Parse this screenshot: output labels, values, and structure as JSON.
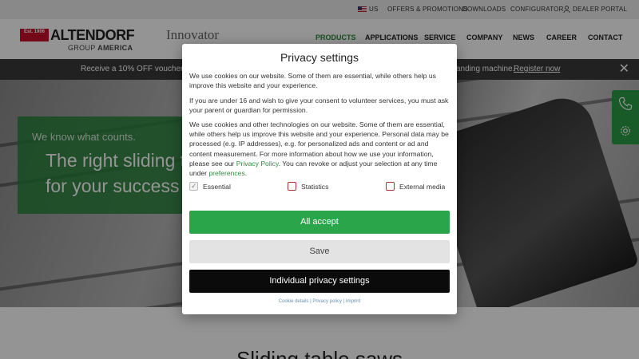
{
  "topbar": {
    "country": "US",
    "offers": "OFFERS & PROMOTIONS",
    "downloads": "DOWNLOADS",
    "configurator": "CONFIGURATOR",
    "dealer_portal": "DEALER PORTAL"
  },
  "header": {
    "logo_est": "Est. 1906",
    "logo_word": "ALTENDORF",
    "logo_group_prefix": "GROUP",
    "logo_group_suffix": "AMERICA",
    "innovator": "Innovator",
    "nav": [
      "PRODUCTS",
      "APPLICATIONS",
      "SERVICE",
      "COMPANY",
      "NEWS",
      "CAREER",
      "CONTACT"
    ]
  },
  "promo": {
    "text_start": "Receive a 10% OFF voucher fo",
    "text_end": "anding machine.",
    "link": "Register now"
  },
  "hero": {
    "tagline": "We know what counts.",
    "slogan_line1": "The right sliding t",
    "slogan_line2": "for your success"
  },
  "lower": {
    "title": "Sliding table saws"
  },
  "modal": {
    "title": "Privacy settings",
    "para1": "We use cookies on our website. Some of them are essential, while others help us improve this website and your experience.",
    "para2": "If you are under 16 and wish to give your consent to volunteer services, you must ask your parent or guardian for permission.",
    "para3_before": "We use cookies and other technologies on our website. Some of them are essential, while others help us improve this website and your experience. Personal data may be processed (e.g. IP addresses), e.g. for personalized ads and content or ad and content measurement. For more information about how we use your information, please see our ",
    "privacy_policy_link": "Privacy Policy",
    "para3_middle": ". You can revoke or adjust your selection at any time under ",
    "preferences_link": "preferences",
    "para3_after": ".",
    "checkboxes": [
      "Essential",
      "Statistics",
      "External media"
    ],
    "accept_all": "All accept",
    "save": "Save",
    "individual": "Individual privacy settings",
    "footer_links": [
      "Cookie details",
      "Privacy policy",
      "Imprint"
    ],
    "footer_sep": "|"
  },
  "colors": {
    "brand_green": "#2aa54a",
    "promo_bg": "#3a3a3a",
    "logo_red": "#c8102e"
  },
  "icons": {
    "phone": "phone-icon",
    "settings": "gear-icon",
    "close": "close-icon",
    "user": "user-icon",
    "flag": "us-flag-icon"
  }
}
